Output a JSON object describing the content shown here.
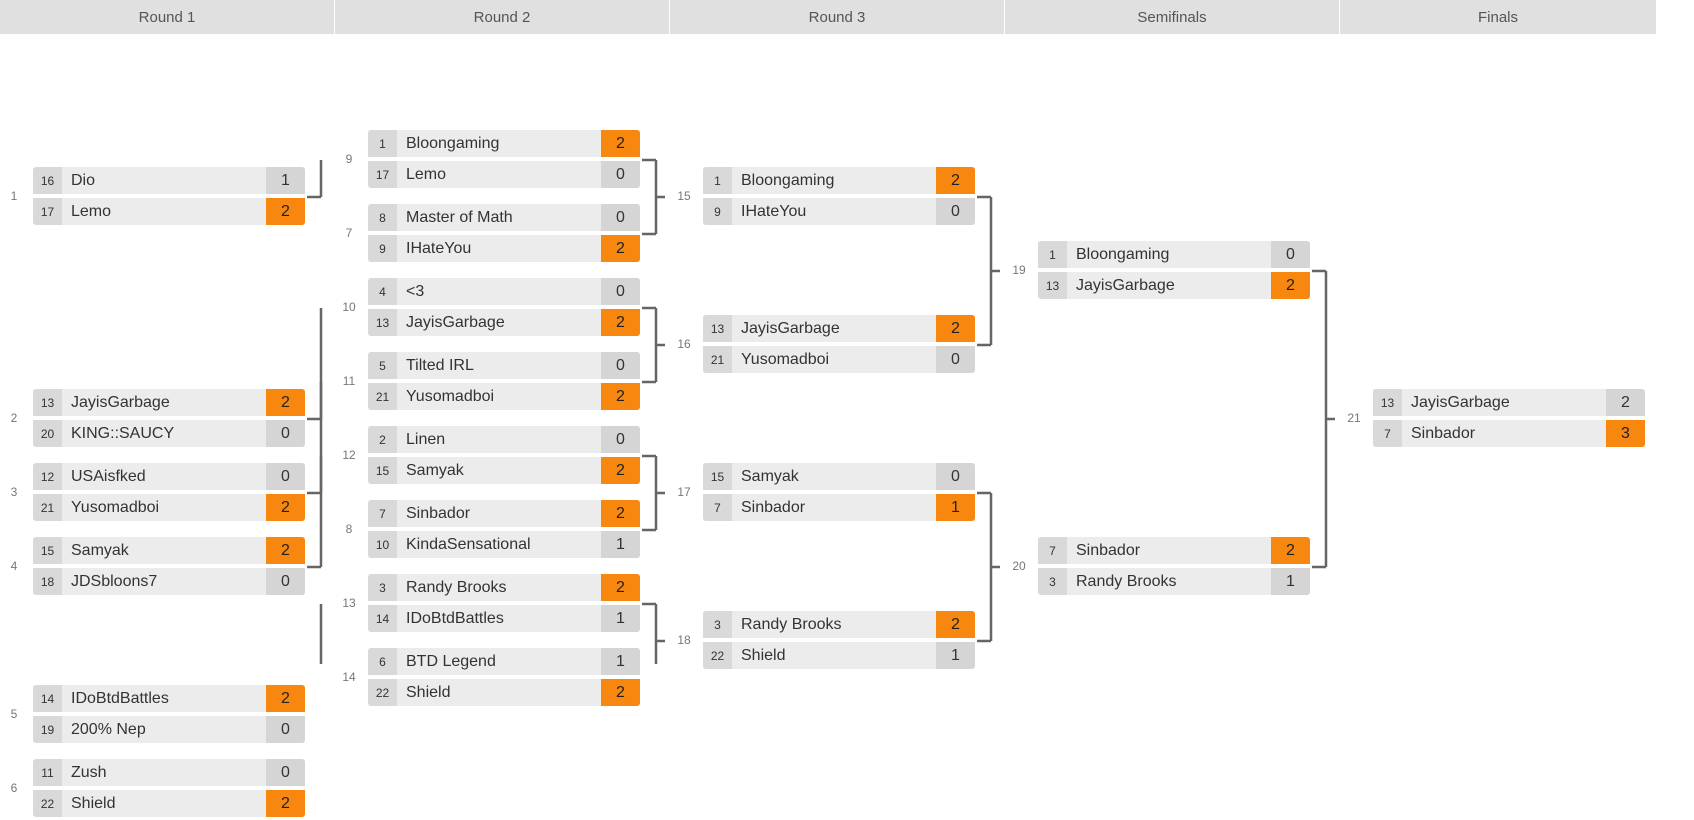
{
  "rounds": [
    "Round 1",
    "Round 2",
    "Round 3",
    "Semifinals",
    "Finals"
  ],
  "matches": [
    {
      "number": "1",
      "round": 0,
      "slot": 1.5,
      "players": [
        {
          "seed": "16",
          "name": "Dio",
          "score": "1",
          "winner": false
        },
        {
          "seed": "17",
          "name": "Lemo",
          "score": "2",
          "winner": true
        }
      ]
    },
    {
      "number": "2",
      "round": 0,
      "slot": 4.5,
      "players": [
        {
          "seed": "13",
          "name": "JayisGarbage",
          "score": "2",
          "winner": true
        },
        {
          "seed": "20",
          "name": "KING::SAUCY",
          "score": "0",
          "winner": false
        }
      ]
    },
    {
      "number": "3",
      "round": 0,
      "slot": 5.5,
      "players": [
        {
          "seed": "12",
          "name": "USAisfked",
          "score": "0",
          "winner": false
        },
        {
          "seed": "21",
          "name": "Yusomadboi",
          "score": "2",
          "winner": true
        }
      ]
    },
    {
      "number": "4",
      "round": 0,
      "slot": 6.5,
      "players": [
        {
          "seed": "15",
          "name": "Samyak",
          "score": "2",
          "winner": true
        },
        {
          "seed": "18",
          "name": "JDSbloons7",
          "score": "0",
          "winner": false
        }
      ]
    },
    {
      "number": "5",
      "round": 0,
      "slot": 8.5,
      "players": [
        {
          "seed": "14",
          "name": "IDoBtdBattles",
          "score": "2",
          "winner": true
        },
        {
          "seed": "19",
          "name": "200% Nep",
          "score": "0",
          "winner": false
        }
      ]
    },
    {
      "number": "6",
      "round": 0,
      "slot": 9.5,
      "players": [
        {
          "seed": "11",
          "name": "Zush",
          "score": "0",
          "winner": false
        },
        {
          "seed": "22",
          "name": "Shield",
          "score": "2",
          "winner": true
        }
      ]
    },
    {
      "number": "9",
      "round": 1,
      "slot": 1,
      "players": [
        {
          "seed": "1",
          "name": "Bloongaming",
          "score": "2",
          "winner": true
        },
        {
          "seed": "17",
          "name": "Lemo",
          "score": "0",
          "winner": false
        }
      ]
    },
    {
      "number": "7",
      "round": 1,
      "slot": 2,
      "players": [
        {
          "seed": "8",
          "name": "Master of Math",
          "score": "0",
          "winner": false
        },
        {
          "seed": "9",
          "name": "IHateYou",
          "score": "2",
          "winner": true
        }
      ]
    },
    {
      "number": "10",
      "round": 1,
      "slot": 3,
      "players": [
        {
          "seed": "4",
          "name": "<3",
          "score": "0",
          "winner": false
        },
        {
          "seed": "13",
          "name": "JayisGarbage",
          "score": "2",
          "winner": true
        }
      ]
    },
    {
      "number": "11",
      "round": 1,
      "slot": 4,
      "players": [
        {
          "seed": "5",
          "name": "Tilted IRL",
          "score": "0",
          "winner": false
        },
        {
          "seed": "21",
          "name": "Yusomadboi",
          "score": "2",
          "winner": true
        }
      ]
    },
    {
      "number": "12",
      "round": 1,
      "slot": 5,
      "players": [
        {
          "seed": "2",
          "name": "Linen",
          "score": "0",
          "winner": false
        },
        {
          "seed": "15",
          "name": "Samyak",
          "score": "2",
          "winner": true
        }
      ]
    },
    {
      "number": "8",
      "round": 1,
      "slot": 6,
      "players": [
        {
          "seed": "7",
          "name": "Sinbador",
          "score": "2",
          "winner": true
        },
        {
          "seed": "10",
          "name": "KindaSensational",
          "score": "1",
          "winner": false
        }
      ]
    },
    {
      "number": "13",
      "round": 1,
      "slot": 7,
      "players": [
        {
          "seed": "3",
          "name": "Randy Brooks",
          "score": "2",
          "winner": true
        },
        {
          "seed": "14",
          "name": "IDoBtdBattles",
          "score": "1",
          "winner": false
        }
      ]
    },
    {
      "number": "14",
      "round": 1,
      "slot": 8,
      "players": [
        {
          "seed": "6",
          "name": "BTD Legend",
          "score": "1",
          "winner": false
        },
        {
          "seed": "22",
          "name": "Shield",
          "score": "2",
          "winner": true
        }
      ]
    },
    {
      "number": "15",
      "round": 2,
      "slot": 1.5,
      "players": [
        {
          "seed": "1",
          "name": "Bloongaming",
          "score": "2",
          "winner": true
        },
        {
          "seed": "9",
          "name": "IHateYou",
          "score": "0",
          "winner": false
        }
      ]
    },
    {
      "number": "16",
      "round": 2,
      "slot": 3.5,
      "players": [
        {
          "seed": "13",
          "name": "JayisGarbage",
          "score": "2",
          "winner": true
        },
        {
          "seed": "21",
          "name": "Yusomadboi",
          "score": "0",
          "winner": false
        }
      ]
    },
    {
      "number": "17",
      "round": 2,
      "slot": 5.5,
      "players": [
        {
          "seed": "15",
          "name": "Samyak",
          "score": "0",
          "winner": false
        },
        {
          "seed": "7",
          "name": "Sinbador",
          "score": "1",
          "winner": true
        }
      ]
    },
    {
      "number": "18",
      "round": 2,
      "slot": 7.5,
      "players": [
        {
          "seed": "3",
          "name": "Randy Brooks",
          "score": "2",
          "winner": true
        },
        {
          "seed": "22",
          "name": "Shield",
          "score": "1",
          "winner": false
        }
      ]
    },
    {
      "number": "19",
      "round": 3,
      "slot": 2.5,
      "players": [
        {
          "seed": "1",
          "name": "Bloongaming",
          "score": "0",
          "winner": false
        },
        {
          "seed": "13",
          "name": "JayisGarbage",
          "score": "2",
          "winner": true
        }
      ]
    },
    {
      "number": "20",
      "round": 3,
      "slot": 6.5,
      "players": [
        {
          "seed": "7",
          "name": "Sinbador",
          "score": "2",
          "winner": true
        },
        {
          "seed": "3",
          "name": "Randy Brooks",
          "score": "1",
          "winner": false
        }
      ]
    },
    {
      "number": "21",
      "round": 4,
      "slot": 4.5,
      "players": [
        {
          "seed": "13",
          "name": "JayisGarbage",
          "score": "2",
          "winner": false
        },
        {
          "seed": "7",
          "name": "Sinbador",
          "score": "3",
          "winner": true
        }
      ]
    }
  ],
  "connections": [
    [
      "1",
      "9"
    ],
    [
      "2",
      "10"
    ],
    [
      "3",
      "11"
    ],
    [
      "4",
      "12"
    ],
    [
      "5",
      "13"
    ],
    [
      "6",
      "14"
    ],
    [
      "9",
      "15"
    ],
    [
      "7",
      "15"
    ],
    [
      "10",
      "16"
    ],
    [
      "11",
      "16"
    ],
    [
      "12",
      "17"
    ],
    [
      "8",
      "17"
    ],
    [
      "13",
      "18"
    ],
    [
      "14",
      "18"
    ],
    [
      "15",
      "19"
    ],
    [
      "16",
      "19"
    ],
    [
      "17",
      "20"
    ],
    [
      "18",
      "20"
    ],
    [
      "19",
      "21"
    ],
    [
      "20",
      "21"
    ]
  ],
  "colors": {
    "winner_score": "#f7870e",
    "loser_score": "#d5d5d5",
    "row_background": "#ececec",
    "seed_background": "#d9d9d9",
    "header_background": "#e0e0e0",
    "connector": "#666666"
  }
}
